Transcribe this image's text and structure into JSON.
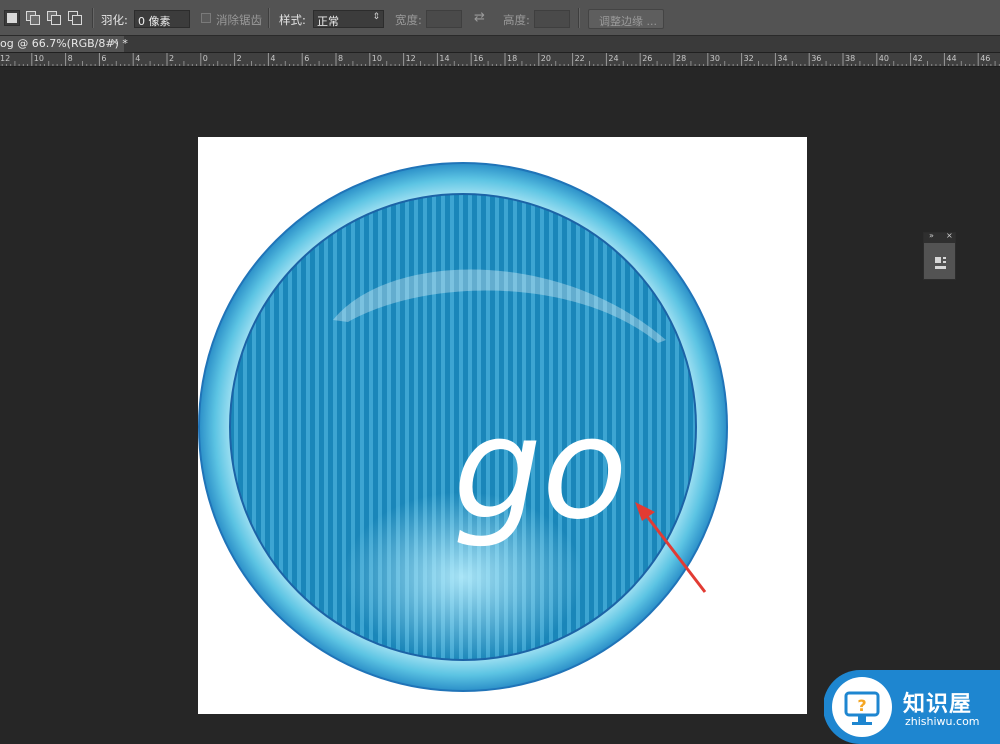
{
  "options_bar": {
    "feather_label": "羽化:",
    "feather_value": "0 像素",
    "antialias_label": "消除锯齿",
    "style_label": "样式:",
    "style_value": "正常",
    "width_label": "宽度:",
    "height_label": "高度:",
    "refine_edge_label": "调整边缘 ..."
  },
  "document_tab": {
    "title": "og @ 66.7%(RGB/8#) *",
    "close_glyph": "×"
  },
  "ruler": {
    "labels": [
      "12",
      "10",
      "8",
      "6",
      "4",
      "2",
      "0",
      "2",
      "4",
      "6",
      "8",
      "10",
      "12",
      "14",
      "16",
      "18",
      "20",
      "22",
      "24",
      "26",
      "28",
      "30",
      "32",
      "34",
      "36",
      "38",
      "40",
      "42",
      "44",
      "46"
    ]
  },
  "artwork": {
    "text": "go",
    "colors": {
      "outer_ring": "#5cc4e3",
      "inner_ring": "#1c63a6",
      "stripe_dark": "#1a86b9",
      "stripe_light": "#3da5d2",
      "arrow": "#e23b33"
    }
  },
  "watermark": {
    "title": "知识屋",
    "url": "zhishiwu.com",
    "colors": {
      "badge": "#1e86d0"
    }
  }
}
